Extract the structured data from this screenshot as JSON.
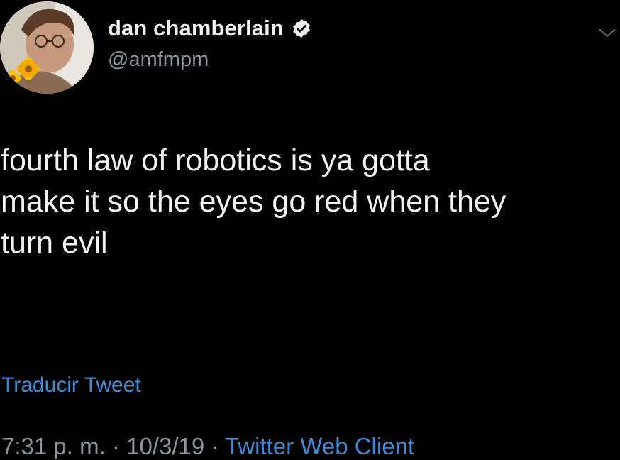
{
  "author": {
    "display_name": "dan chamberlain",
    "handle": "@amfmpm",
    "verified": true,
    "avatar_icon": "profile-photo"
  },
  "tweet": {
    "text": "fourth law of robotics is ya gotta\nmake it so the eyes go red when they\nturn evil",
    "translate_label": "Traducir Tweet",
    "time": "7:31 p. m.",
    "separator": "·",
    "date": "10/3/19",
    "source": "Twitter Web Client"
  },
  "colors": {
    "background": "#000000",
    "link": "#3d8bd6",
    "secondary_text": "#8f959a",
    "primary_text": "#f4f4f4"
  },
  "icons": {
    "verified": "verified-badge-icon",
    "menu": "chevron-down-icon"
  }
}
